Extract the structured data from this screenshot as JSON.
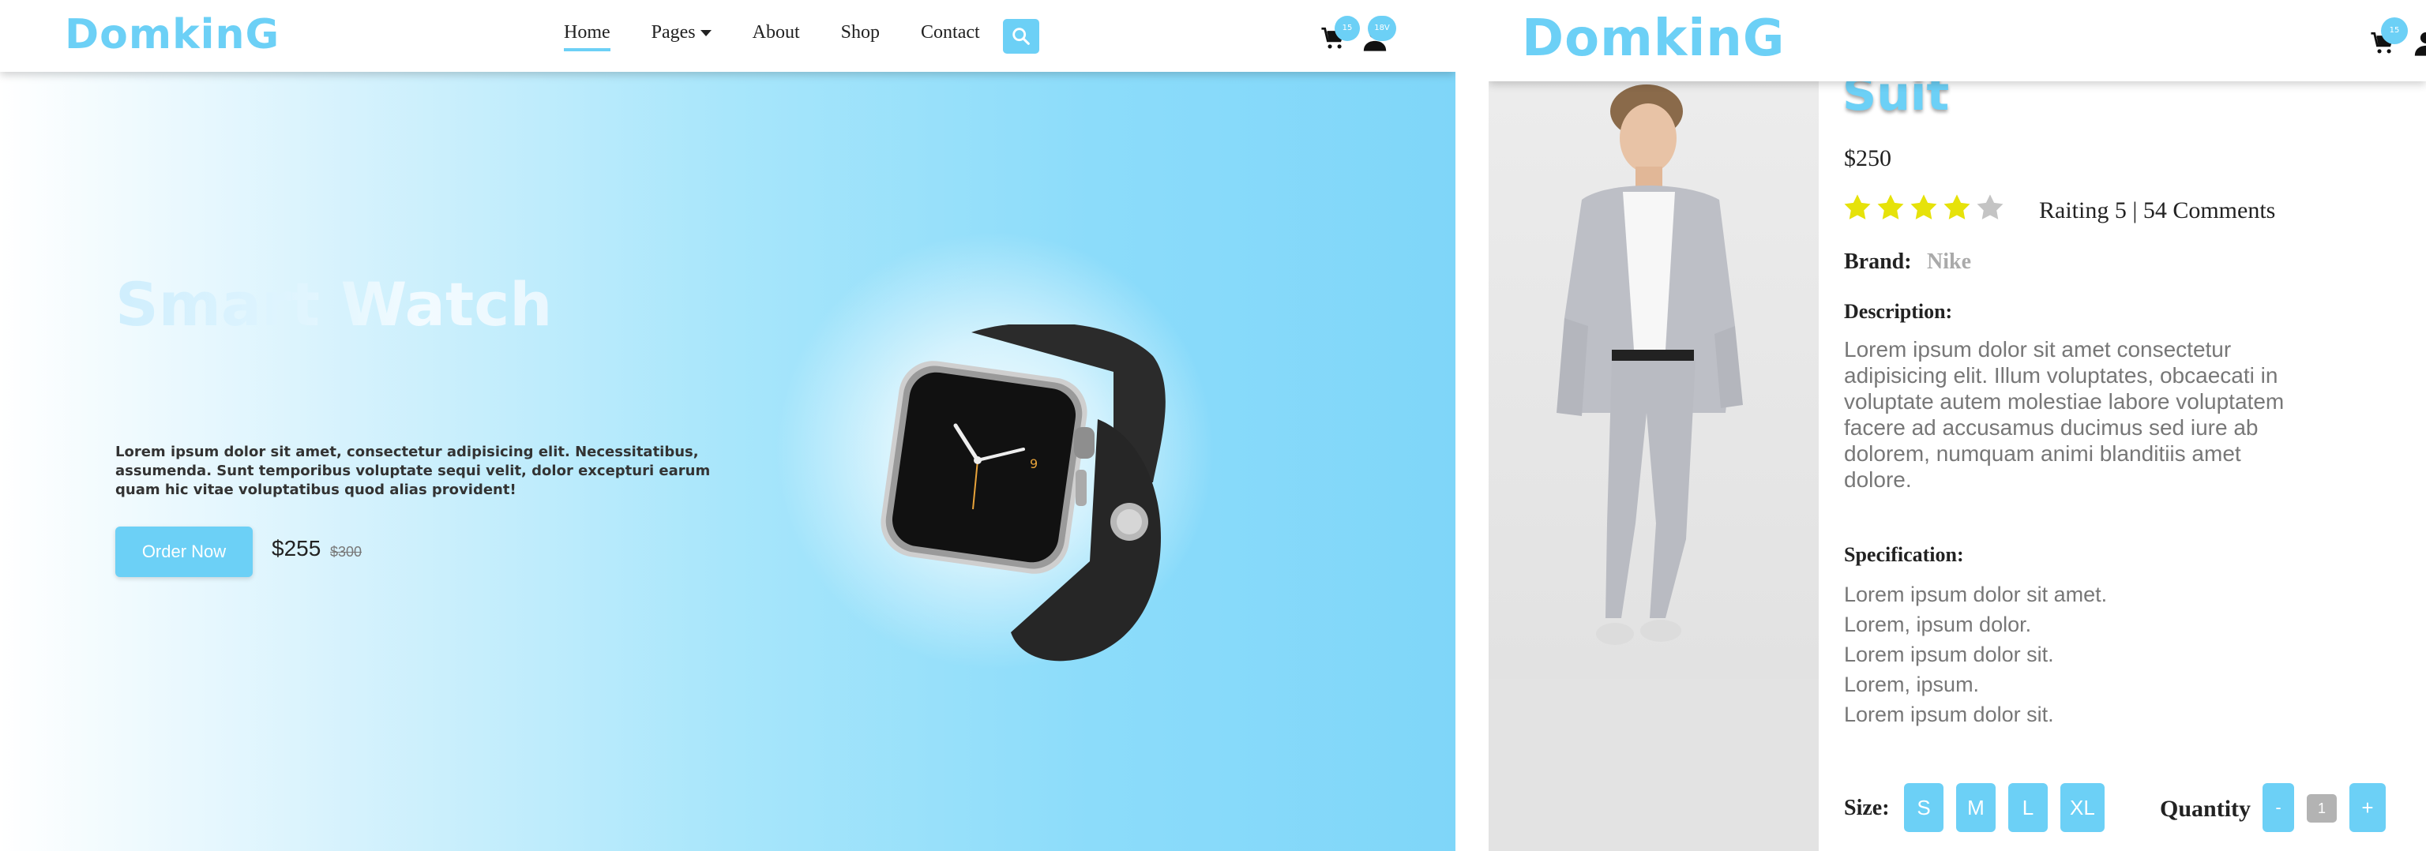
{
  "brand": {
    "logo": "DomkinG",
    "accent": "#6cd0f6"
  },
  "left": {
    "nav": {
      "items": [
        {
          "label": "Home",
          "active": true
        },
        {
          "label": "Pages"
        },
        {
          "label": "About"
        },
        {
          "label": "Shop"
        },
        {
          "label": "Contact"
        }
      ],
      "cart_count": "15",
      "user_badge": "18V",
      "icons": [
        "search-icon",
        "cart-icon",
        "user-icon",
        "caret-down-icon"
      ]
    },
    "hero": {
      "title": "Smart Watch",
      "description": "Lorem ipsum dolor sit amet, consectetur adipisicing elit. Necessitatibus, assumenda. Sunt temporibus voluptate sequi velit, dolor excepturi earum quam hic vitae voluptatibus quod alias provident!",
      "button": "Order Now",
      "price": "$255",
      "old_price": "$300"
    }
  },
  "right": {
    "nav": {
      "cart_count": "15"
    },
    "product": {
      "title": "Suit",
      "price": "$250",
      "rating_stars": 4,
      "rating_max": 5,
      "rating_text": "Raiting 5 | 54 Comments",
      "brand_label": "Brand:",
      "brand_value": "Nike",
      "description_label": "Description:",
      "description": "Lorem ipsum dolor sit amet consectetur adipisicing elit. Illum voluptates, obcaecati in voluptate autem molestiae labore voluptatem facere ad accusamus ducimus sed iure ab dolorem, numquam animi blanditiis amet dolore.",
      "specification_label": "Specification:",
      "specifications": [
        "Lorem ipsum dolor sit amet.",
        "Lorem, ipsum dolor.",
        "Lorem ipsum dolor sit.",
        "Lorem, ipsum.",
        "Lorem ipsum dolor sit."
      ],
      "size_label": "Size:",
      "sizes": [
        "S",
        "M",
        "L",
        "XL"
      ],
      "quantity_label": "Quantity",
      "quantity_minus": "-",
      "quantity_value": "1",
      "quantity_plus": "+"
    }
  }
}
